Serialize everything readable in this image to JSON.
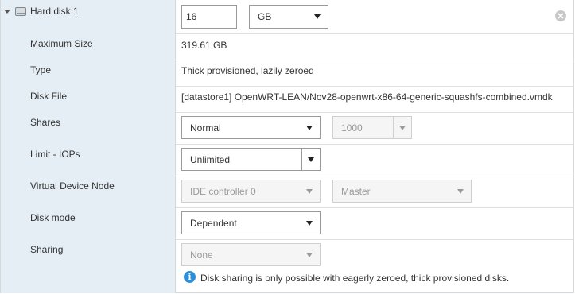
{
  "disk": {
    "title": "Hard disk 1",
    "size_value": "16",
    "size_unit": "GB",
    "expander_icon": "chevron-down-icon",
    "disk_icon": "hard-disk-icon",
    "remove_icon": "close-circle-icon"
  },
  "rows": {
    "max_size": {
      "label": "Maximum Size",
      "value": "319.61 GB"
    },
    "type": {
      "label": "Type",
      "value": "Thick provisioned, lazily zeroed"
    },
    "disk_file": {
      "label": "Disk File",
      "value": "[datastore1] OpenWRT-LEAN/Nov28-openwrt-x86-64-generic-squashfs-combined.vmdk"
    },
    "shares": {
      "label": "Shares",
      "value": "Normal",
      "number": "1000"
    },
    "limit": {
      "label": "Limit - IOPs",
      "value": "Unlimited"
    },
    "vdn": {
      "label": "Virtual Device Node",
      "controller": "IDE controller 0",
      "position": "Master"
    },
    "disk_mode": {
      "label": "Disk mode",
      "value": "Dependent"
    },
    "sharing": {
      "label": "Sharing",
      "value": "None",
      "note": "Disk sharing is only possible with eagerly zeroed, thick provisioned disks.",
      "note_icon": "info-icon"
    }
  },
  "colors": {
    "label_bg": "#e5eef5",
    "info_blue": "#2c8ed6",
    "border": "#dfe3e6"
  }
}
